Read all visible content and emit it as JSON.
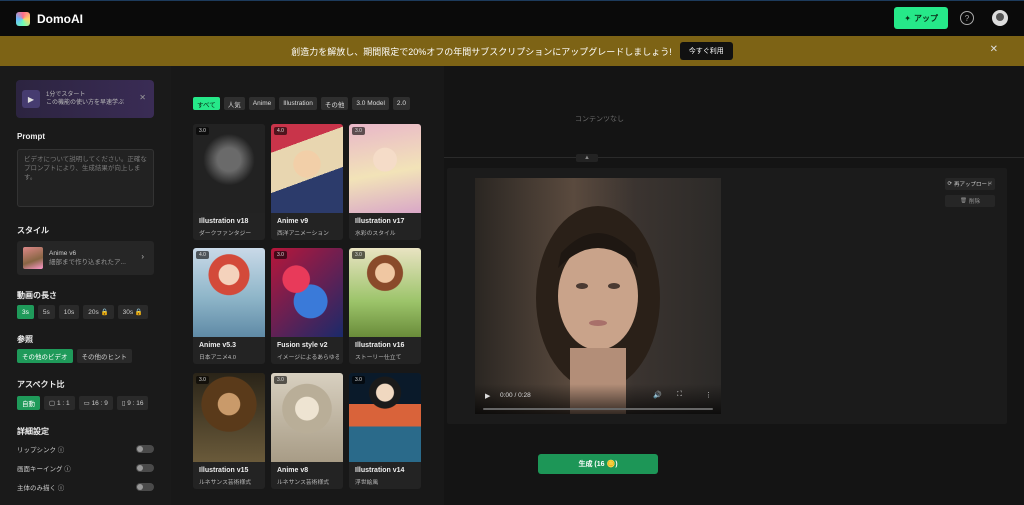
{
  "app": {
    "name": "DomoAI",
    "upgrade_label": "アップ"
  },
  "banner": {
    "message": "創造力を解放し、期間限定で20%オフの年間サブスクリプションにアップグレードしましょう!",
    "cta_label": "今すぐ利用",
    "close_glyph": "✕"
  },
  "sidebar": {
    "tutorial": {
      "text": "1分でスタート\nこの機能の使い方を早速学ぶ",
      "close_glyph": "✕"
    },
    "prompt": {
      "label": "Prompt",
      "placeholder": "ビデオについて説明してください。正確なプロンプトにより、生成結果が向上します。"
    },
    "style": {
      "label": "スタイル",
      "name": "Anime v6",
      "desc": "細部まで作り込まれたア..."
    },
    "duration": {
      "label": "動画の長さ",
      "options": [
        "3s",
        "5s",
        "10s",
        "20s 🔒",
        "30s 🔒"
      ]
    },
    "reference": {
      "label": "参照",
      "options": [
        "その他のビデオ",
        "その他のヒント"
      ]
    },
    "aspect": {
      "label": "アスペクト比",
      "options": [
        "自動",
        "1 : 1",
        "16 : 9",
        "9 : 16"
      ]
    },
    "advanced": {
      "label": "詳細設定",
      "toggles": [
        "リップシンク ⓘ",
        "画面キーイング ⓘ",
        "主体のみ描く ⓘ"
      ]
    }
  },
  "gallery": {
    "filters": [
      "すべて",
      "人気",
      "Anime",
      "Illustration",
      "その他",
      "3.0 Model",
      "2.0"
    ],
    "cards": [
      {
        "badge": "3.0",
        "name": "Illustration v18",
        "desc": "ダークファンタジー"
      },
      {
        "badge": "4.0",
        "name": "Anime v9",
        "desc": "西洋アニメーション"
      },
      {
        "badge": "3.0",
        "name": "Illustration v17",
        "desc": "水彩のスタイル"
      },
      {
        "badge": "4.0",
        "name": "Anime v5.3",
        "desc": "日本アニメ4.0"
      },
      {
        "badge": "3.0",
        "name": "Fusion style v2",
        "desc": "イメージによるあらゆる..."
      },
      {
        "badge": "3.0",
        "name": "Illustration v16",
        "desc": "ストーリー仕立て"
      },
      {
        "badge": "3.0",
        "name": "Illustration v15",
        "desc": "ルネサンス芸術様式"
      },
      {
        "badge": "3.0",
        "name": "Anime v8",
        "desc": "ルネサンス芸術様式"
      },
      {
        "badge": "3.0",
        "name": "Illustration v14",
        "desc": "浮世絵風"
      }
    ]
  },
  "workspace": {
    "empty_text": "コンテンツなし",
    "video": {
      "time": "0:00 / 0:28"
    },
    "reupload_label": "再アップロード",
    "delete_label": "削除",
    "generate_label": "生成 (16 🪙)"
  }
}
